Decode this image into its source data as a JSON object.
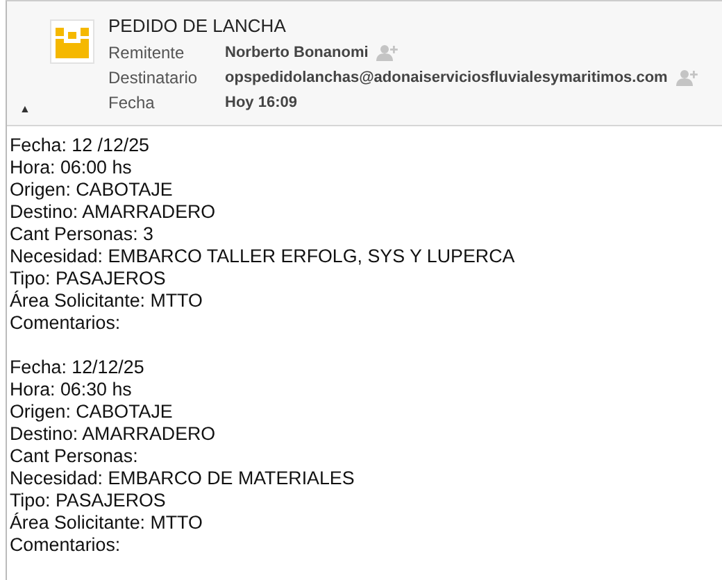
{
  "subject": "PEDIDO DE LANCHA",
  "fields": [
    {
      "label": "Remitente",
      "value": "Norberto Bonanomi",
      "add_contact": true
    },
    {
      "label": "Destinatario",
      "value": "opspedidolanchas@adonaiserviciosfluvialesymaritimos.com",
      "add_contact": true
    },
    {
      "label": "Fecha",
      "value": "Hoy 16:09",
      "add_contact": false
    }
  ],
  "collapse_toggle": "▲",
  "body": [
    [
      "Fecha: 12 /12/25",
      "Hora: 06:00 hs",
      "Origen: CABOTAJE",
      "Destino: AMARRADERO",
      "Cant Personas: 3",
      "Necesidad: EMBARCO TALLER ERFOLG, SYS Y LUPERCA",
      "Tipo: PASAJEROS",
      "Área Solicitante: MTTO",
      "Comentarios:"
    ],
    [
      "Fecha: 12/12/25",
      "Hora: 06:30 hs",
      "Origen: CABOTAJE",
      "Destino: AMARRADERO",
      "Cant Personas:",
      "Necesidad: EMBARCO DE MATERIALES",
      "Tipo: PASAJEROS",
      "Área Solicitante: MTTO",
      "Comentarios:"
    ]
  ]
}
